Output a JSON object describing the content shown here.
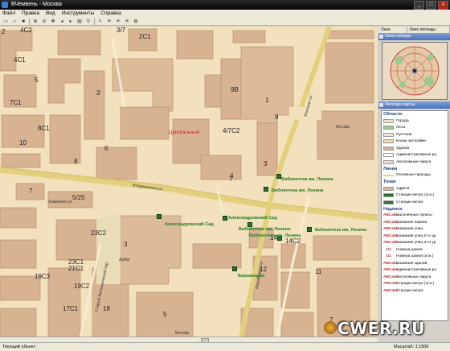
{
  "window": {
    "title": "ВЧемвень - Москва",
    "min": "_",
    "max": "□",
    "close": "x"
  },
  "menu": [
    "Файл",
    "Правка",
    "Вид",
    "Инструменты",
    "Справка"
  ],
  "toolbar_icons": [
    "new-icon",
    "open-icon",
    "save-icon",
    "print-icon",
    "zoom-in-icon",
    "zoom-out-icon",
    "pan-icon",
    "select-icon",
    "measure-icon",
    "search-icon",
    "back-icon",
    "forward-icon"
  ],
  "map": {
    "labels": [
      "2",
      "4С2",
      "3/7",
      "2С1",
      "4С1",
      "3",
      "9В",
      "1",
      "7С1",
      "5",
      "8С1",
      "10",
      "8",
      "6",
      "4/7С2",
      "9",
      "3",
      "7",
      "4",
      "5/25",
      "7",
      "23С2",
      "3",
      "14",
      "14С2",
      "23С1",
      "21С1",
      "19С3",
      "12",
      "11",
      "18",
      "19С2",
      "5",
      "17С1",
      "7"
    ],
    "red_label": "Центральный",
    "street_labels": [
      "Воздвиженка ул.",
      "Моховая ул.",
      "Знаменка ул.",
      "Боровицкая пл.",
      "Старый Ваганьковский пер.",
      "Москва",
      "Арбат",
      "Москва"
    ],
    "poi_labels": [
      "Библиотека им. Ленина",
      "Библиотека им. Ленина",
      "Александровский Сад",
      "Александровский Сад",
      "Библиотека им. Ленина",
      "Библиотека им. Ленина",
      "Боровицкая",
      "Библиотека им. Ленина"
    ]
  },
  "side": {
    "overview_title": "Окно обзора",
    "tabs": [
      "Окно обзора",
      "Окно легенды карты"
    ],
    "legend_title": "Легенда карты",
    "legend_rows": [
      {
        "label": "Области",
        "type": "title"
      },
      {
        "label": "Города",
        "color": "#f3e1bd"
      },
      {
        "label": "Леса",
        "color": "#9cc98f"
      },
      {
        "label": "Пустоши",
        "color": "#e8e4d6"
      },
      {
        "label": "Блоки застройки",
        "color": "#f0d9b0"
      },
      {
        "label": "Здания",
        "color": "#d7b391"
      },
      {
        "label": "Административные ра",
        "color": "#ffffff"
      },
      {
        "label": "Автономные округа",
        "color": "#f6d3d3"
      },
      {
        "label": "Линии",
        "type": "title"
      },
      {
        "label": "Основные проезды",
        "color": "#e3d07d",
        "line": true
      },
      {
        "label": "Точки",
        "type": "title"
      },
      {
        "label": "Адреса",
        "color": "#d7b391"
      },
      {
        "label": "Станции метро (осн.)",
        "color": "#2f6f2f"
      },
      {
        "label": "Станции метро",
        "color": "#2f6f2f"
      },
      {
        "label": "Надписи",
        "type": "title"
      },
      {
        "label": "Населённые пункты",
        "text": "ABCabc"
      },
      {
        "label": "Названия парков",
        "text": "ABCabc"
      },
      {
        "label": "Названия улиц",
        "text": "ABCabc"
      },
      {
        "label": "Названия улиц 2-го ур",
        "text": "ABCabc"
      },
      {
        "label": "Названия улиц 3-го ур",
        "text": "ABCabc"
      },
      {
        "label": "Номера домов",
        "text": "1/1"
      },
      {
        "label": "Номера домов (осн.)",
        "text": "1/1"
      },
      {
        "label": "Названия зданий",
        "text": "ABCabc"
      },
      {
        "label": "Административные ра",
        "text": "ABCabc"
      },
      {
        "label": "Автономные округа",
        "text": "ABCabc"
      },
      {
        "label": "Станции метро (осн.)",
        "text": "ABCabc"
      },
      {
        "label": "Станции метро",
        "text": "ABCabc"
      }
    ]
  },
  "status": {
    "left": "Текущий объект:",
    "right": "Масштаб: 1:1500"
  },
  "watermark": "CWER.RU"
}
